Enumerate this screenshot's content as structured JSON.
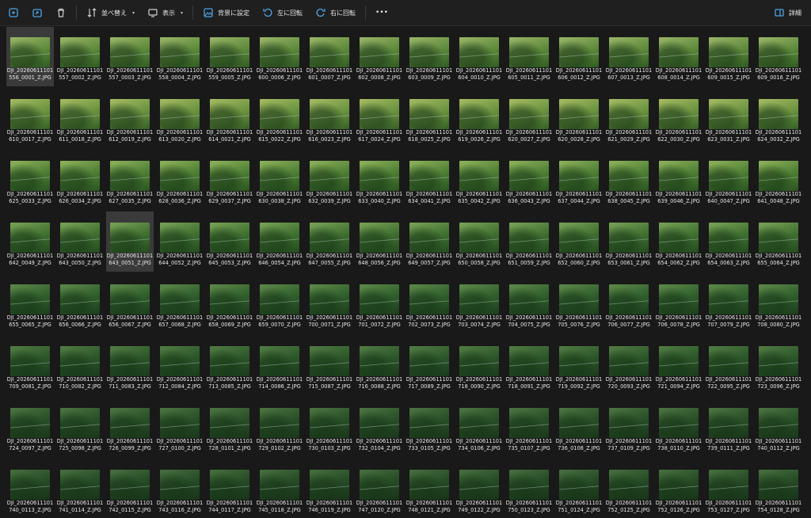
{
  "toolbar": {
    "buttons": [
      {
        "icon": "copy-icon",
        "label": ""
      },
      {
        "icon": "share-icon",
        "label": ""
      },
      {
        "icon": "trash-icon",
        "label": ""
      },
      {
        "icon": "sort-icon",
        "label": "並べ替え",
        "dropdown": true
      },
      {
        "icon": "view-icon",
        "label": "表示",
        "dropdown": true
      },
      {
        "icon": "set-background-icon",
        "label": "背景に設定"
      },
      {
        "icon": "rotate-left-icon",
        "label": "左に回転"
      },
      {
        "icon": "rotate-right-icon",
        "label": "右に回転"
      },
      {
        "icon": "more-icon",
        "label": "•••"
      }
    ],
    "details": {
      "icon": "details-pane-icon",
      "label": "詳細"
    }
  },
  "files": {
    "prefix": "DJI_20260611101",
    "suffix": "_Z.JPG",
    "names": [
      "556_0001",
      "557_0002",
      "557_0003",
      "558_0004",
      "559_0005",
      "600_0006",
      "601_0007",
      "602_0008",
      "603_0009",
      "604_0010",
      "605_0011",
      "606_0012",
      "607_0013",
      "608_0014",
      "609_0015",
      "609_0016",
      "610_0017",
      "611_0018",
      "612_0019",
      "613_0020",
      "614_0021",
      "615_0022",
      "616_0023",
      "617_0024",
      "618_0025",
      "619_0026",
      "620_0027",
      "620_0028",
      "621_0029",
      "622_0030",
      "623_0031",
      "624_0032",
      "625_0033",
      "626_0034",
      "627_0035",
      "628_0036",
      "629_0037",
      "630_0038",
      "632_0039",
      "633_0040",
      "634_0041",
      "635_0042",
      "636_0043",
      "637_0044",
      "638_0045",
      "639_0046",
      "640_0047",
      "641_0048",
      "642_0049",
      "643_0050",
      "643_0051",
      "644_0052",
      "645_0053",
      "646_0054",
      "647_0055",
      "648_0056",
      "649_0057",
      "650_0058",
      "651_0059",
      "652_0060",
      "653_0061",
      "654_0062",
      "654_0063",
      "655_0064",
      "655_0065",
      "656_0066",
      "656_0067",
      "657_0068",
      "658_0069",
      "659_0070",
      "700_0071",
      "701_0072",
      "702_0073",
      "703_0074",
      "704_0075",
      "705_0076",
      "706_0077",
      "706_0078",
      "707_0079",
      "708_0080",
      "709_0081",
      "710_0082",
      "711_0083",
      "712_0084",
      "713_0085",
      "714_0086",
      "715_0087",
      "716_0088",
      "717_0089",
      "718_0090",
      "718_0091",
      "719_0092",
      "720_0093",
      "721_0094",
      "722_0095",
      "723_0096",
      "724_0097",
      "725_0098",
      "726_0099",
      "727_0100",
      "728_0101",
      "729_0102",
      "730_0103",
      "732_0104",
      "733_0105",
      "734_0106",
      "735_0107",
      "736_0108",
      "737_0109",
      "738_0110",
      "739_0111",
      "740_0112",
      "740_0113",
      "741_0114",
      "742_0115",
      "743_0116",
      "744_0117",
      "745_0118",
      "746_0119",
      "747_0120",
      "748_0121",
      "749_0122",
      "750_0123",
      "751_0124",
      "752_0125",
      "752_0126",
      "753_0127",
      "754_0128"
    ],
    "selected": [
      0,
      50
    ]
  },
  "thumb_palettes": [
    [
      "#9bb56a",
      "#5e8a3b",
      "#2f5a22"
    ],
    [
      "#a6bb62",
      "#6b9340",
      "#355f25"
    ],
    [
      "#8fb35c",
      "#4e7f34",
      "#2a5420"
    ],
    [
      "#7aa357",
      "#3f7030",
      "#244a1f"
    ],
    [
      "#5e8a4a",
      "#2f5e2c",
      "#1d3d1c"
    ],
    [
      "#527d44",
      "#2b5629",
      "#1b391b"
    ],
    [
      "#4d7542",
      "#284f27",
      "#19361a"
    ],
    [
      "#47703f",
      "#254a25",
      "#183318"
    ]
  ]
}
